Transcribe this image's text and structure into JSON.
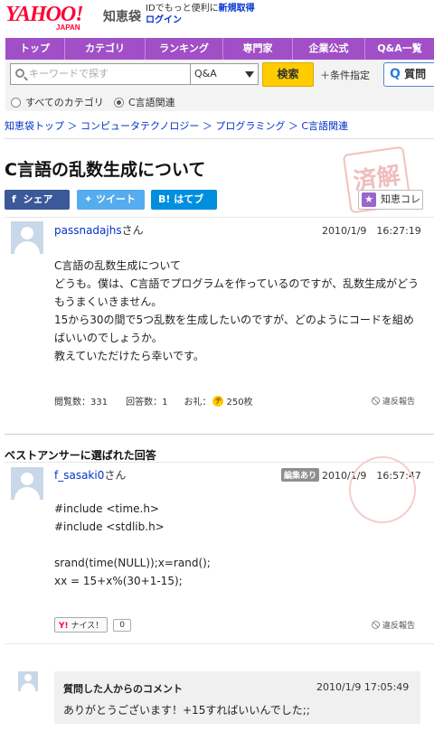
{
  "header": {
    "logo_text": "YAHOO!",
    "logo_sub": "JAPAN",
    "brand": "知恵袋",
    "login_note": "IDでもっと便利に",
    "register_link": "新規取得",
    "login_link": "ログイン"
  },
  "nav": {
    "items": [
      {
        "label": "トップ"
      },
      {
        "label": "カテゴリ"
      },
      {
        "label": "ランキング"
      },
      {
        "label": "専門家"
      },
      {
        "label": "企業公式"
      },
      {
        "label": "Q&A一覧"
      }
    ]
  },
  "search": {
    "placeholder": "キーワードで探す",
    "scope_value": "Q&A",
    "search_button": "検索",
    "conditions_link": "＋条件指定",
    "ask_button": "質問"
  },
  "radios": {
    "all_label": "すべてのカテゴリ",
    "c_label": "C言語関連",
    "selected": "C言語関連"
  },
  "breadcrumb": "知恵袋トップ ＞ コンピュータテクノロジー ＞ プログラミング ＞ C言語関連",
  "question": {
    "title": "C言語の乱数生成について",
    "resolved_stamp": "済解",
    "author": "passnadajhs",
    "honorific": "さん",
    "timestamp": "2010/1/9　16:27:19",
    "body": [
      "C言語の乱数生成について",
      "どうも。僕は、C言語でプログラムを作っているのですが、乱数生成がどう",
      "もうまくいきません。",
      "15から30の間で5つ乱数を生成したいのですが、どのようにコードを組め",
      "ばいいのでしょうか。",
      "教えていただけたら幸いです。"
    ],
    "views": "閲覧数：331",
    "answers": "回答数：1",
    "reward_label": "お礼：",
    "reward": "250枚",
    "coin_glyph": "チ",
    "report": "違反報告"
  },
  "share": {
    "facebook": "シェア",
    "twitter": "ツイート",
    "hatena": "はてブ",
    "collect": "知恵コレ",
    "colors": {
      "facebook": "#3b5998",
      "twitter": "#55acee",
      "hatena": "#008fde"
    }
  },
  "best_answer": {
    "section_title": "ベストアンサーに選ばれた回答",
    "author": "f_sasaki0",
    "honorific": "さん",
    "edited_badge": "編集あり",
    "timestamp": "2010/1/9　16:57:47",
    "code": "#include <time.h>\n#include <stdlib.h>\n\nsrand(time(NULL));x=rand();\nxx = 15+x%(30+1-15);",
    "nice_label": "ナイス！",
    "nice_count": "0",
    "report": "違反報告"
  },
  "comment": {
    "heading": "質問した人からのコメント",
    "timestamp": "2010/1/9 17:05:49",
    "text": "ありがとうございます！+15すればいいんでした;;"
  }
}
